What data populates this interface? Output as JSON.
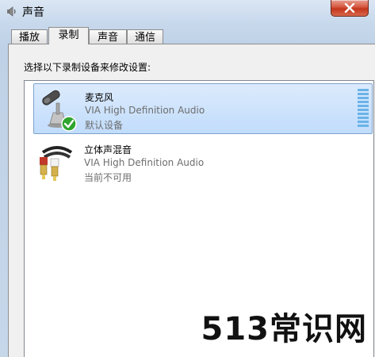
{
  "window": {
    "title": "声音"
  },
  "tabs": [
    {
      "label": "播放"
    },
    {
      "label": "录制",
      "active": true
    },
    {
      "label": "声音"
    },
    {
      "label": "通信"
    }
  ],
  "recording": {
    "instruction": "选择以下录制设备来修改设置:",
    "devices": [
      {
        "name": "麦克风",
        "driver": "VIA High Definition Audio",
        "status": "默认设备",
        "icon": "microphone-icon",
        "selected": true,
        "is_default": true
      },
      {
        "name": "立体声混音",
        "driver": "VIA High Definition Audio",
        "status": "当前不可用",
        "icon": "audio-cable-icon",
        "selected": false,
        "is_default": false
      }
    ]
  },
  "watermark": "513常识网",
  "colors": {
    "selection_bg": "#c9e0fb",
    "selection_border": "#7da2ce",
    "level_meter": "#6ab3e8",
    "default_check": "#2fa52f"
  }
}
